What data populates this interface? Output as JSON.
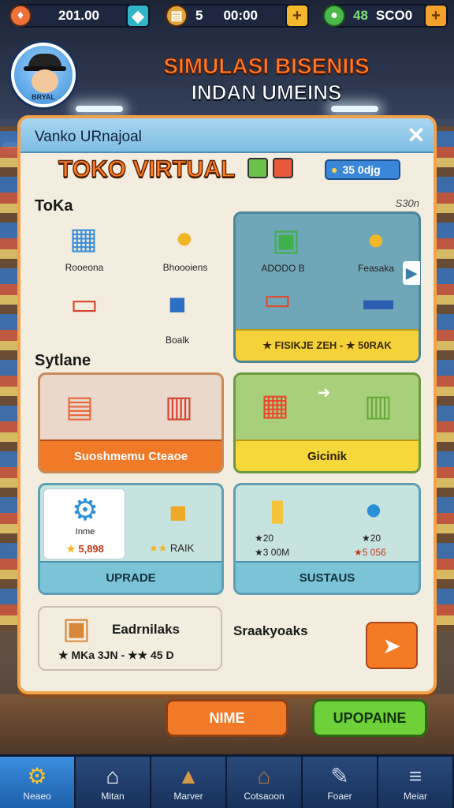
{
  "topbar": {
    "res1_value": "201.00",
    "res2_value": "5",
    "res2_value_b": "00:00",
    "res3_value": "48",
    "res3_value_b": "SCO0",
    "plus": "+"
  },
  "player": {
    "name": "BRYAL"
  },
  "title": {
    "line1": "SIMULASI BISENIIS",
    "line2": "INDAN UMEINS"
  },
  "panel": {
    "header_label": "Vanko URnajoal",
    "close": "✕",
    "store_title": "TOKO VIRTUAL",
    "coin_badge": "35 0djg",
    "section1": "ToKa",
    "section1_right": "S30n",
    "items": [
      {
        "label": "Rooeona"
      },
      {
        "label": "Bhoooiens"
      },
      {
        "label": ""
      },
      {
        "label": "Boalk"
      }
    ],
    "featured": {
      "label1": "ADODO B",
      "label2": "Feasaka",
      "button": "★ FISIKJE ZEH - ★ 50RAK"
    },
    "section2": "Sytlane",
    "card_orange": {
      "button": "Suoshmemu Cteaoe"
    },
    "card_green": {
      "button": "Gicinik"
    },
    "card_upgrade": {
      "tile_label": "Inme",
      "tile_price": "5,898",
      "rating": "RAIK",
      "button": "UPRADE"
    },
    "card_stats": {
      "stat1": "★20",
      "stat1b": "★3 00M",
      "stat2": "★20",
      "stat2b": "★5 056",
      "button": "SUSTAUS"
    },
    "bottom_card": {
      "title": "Eadrnilaks",
      "line": "★ MKa 3JN - ★★ 45 D"
    },
    "bottom_right": "Sraakyoaks",
    "go_arrow": "➤"
  },
  "buttons": {
    "nime": "NIME",
    "upopaine": "UPOPAINE"
  },
  "nav": [
    {
      "label": "Neaeo",
      "icon": "gear-icon"
    },
    {
      "label": "Mitan",
      "icon": "house-icon"
    },
    {
      "label": "Marver",
      "icon": "arrow-up-icon"
    },
    {
      "label": "Cotsaoon",
      "icon": "shop-icon"
    },
    {
      "label": "Foaer",
      "icon": "tool-icon"
    },
    {
      "label": "Meiar",
      "icon": "menu-icon"
    }
  ]
}
